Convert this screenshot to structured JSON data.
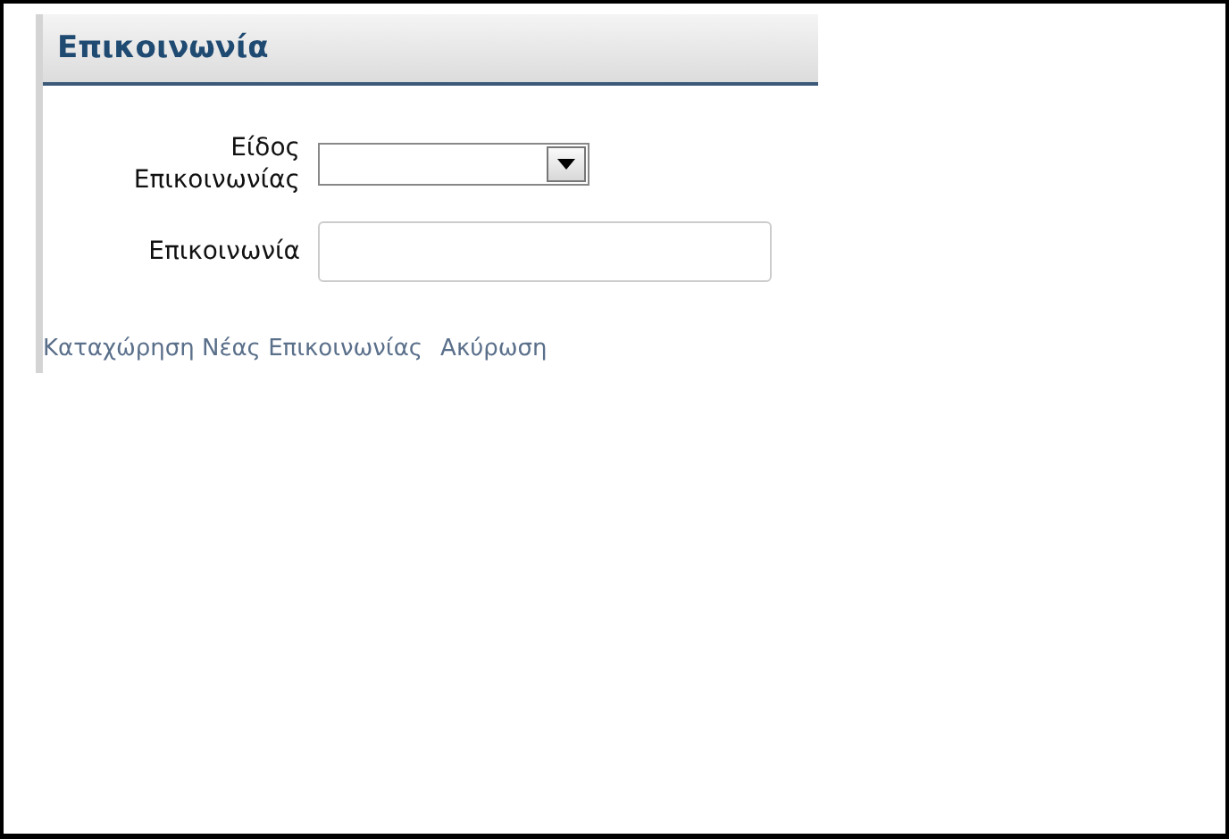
{
  "panel": {
    "title": "Επικοινωνία"
  },
  "fields": [
    {
      "kind": "select",
      "label": "Είδος Επικοινωνίας"
    },
    {
      "kind": "text",
      "label": "Επικοινωνία"
    }
  ],
  "links": [
    "Καταχώρηση Νέας Επικοινωνίας",
    "Ακύρωση"
  ]
}
